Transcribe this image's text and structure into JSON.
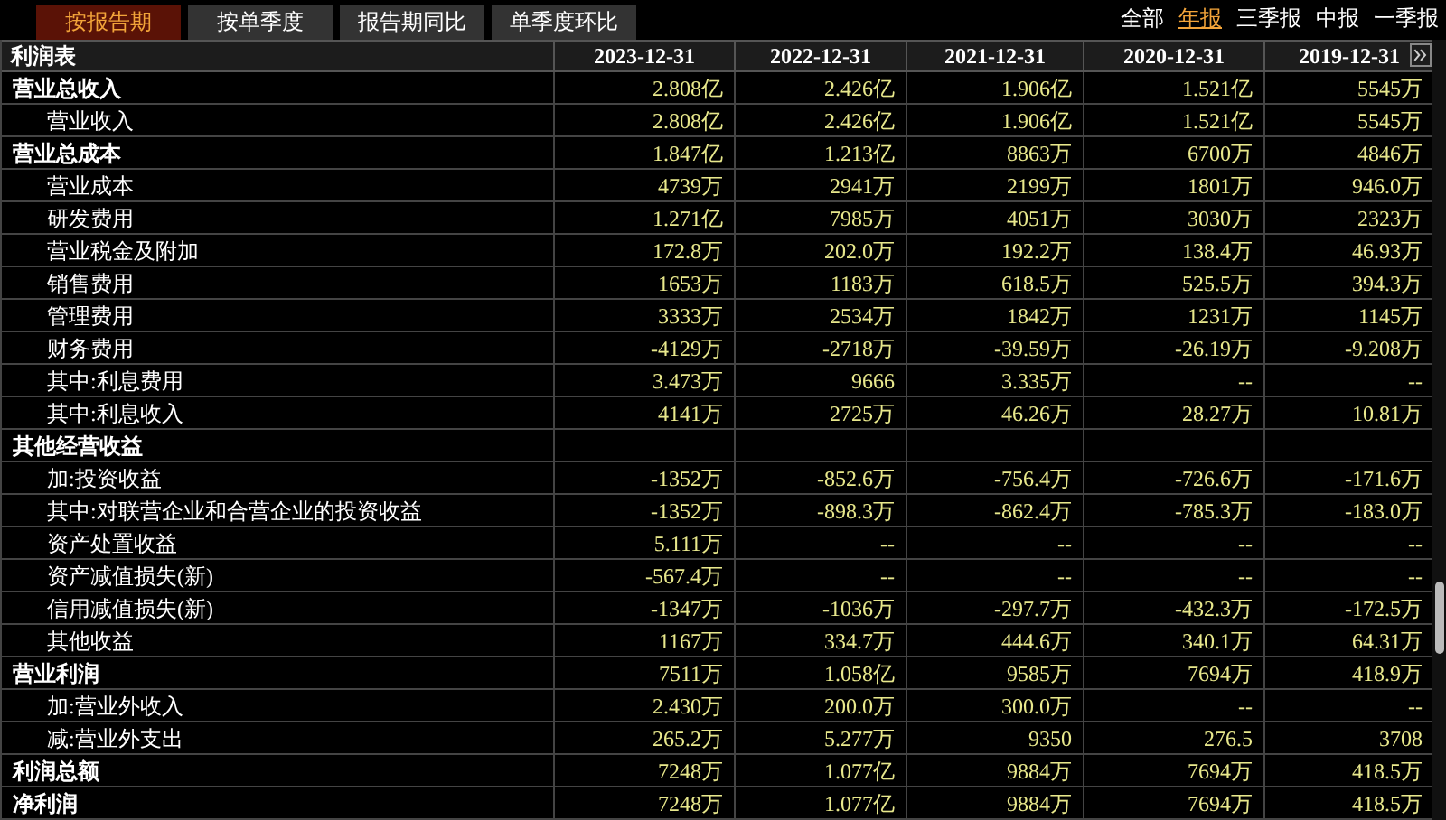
{
  "tabs": [
    {
      "label": "按报告期",
      "selected": true
    },
    {
      "label": "按单季度",
      "selected": false
    },
    {
      "label": "报告期同比",
      "selected": false
    },
    {
      "label": "单季度环比",
      "selected": false
    }
  ],
  "filters": [
    {
      "label": "全部",
      "selected": false
    },
    {
      "label": "年报",
      "selected": true
    },
    {
      "label": "三季报",
      "selected": false
    },
    {
      "label": "中报",
      "selected": false
    },
    {
      "label": "一季报",
      "selected": false
    }
  ],
  "table": {
    "title": "利润表",
    "columns": [
      "2023-12-31",
      "2022-12-31",
      "2021-12-31",
      "2020-12-31",
      "2019-12-31"
    ],
    "rows": [
      {
        "kind": "section",
        "label": "营业总收入",
        "values": [
          "2.808亿",
          "2.426亿",
          "1.906亿",
          "1.521亿",
          "5545万"
        ]
      },
      {
        "kind": "item",
        "label": "营业收入",
        "values": [
          "2.808亿",
          "2.426亿",
          "1.906亿",
          "1.521亿",
          "5545万"
        ]
      },
      {
        "kind": "section",
        "label": "营业总成本",
        "values": [
          "1.847亿",
          "1.213亿",
          "8863万",
          "6700万",
          "4846万"
        ]
      },
      {
        "kind": "item",
        "label": "营业成本",
        "values": [
          "4739万",
          "2941万",
          "2199万",
          "1801万",
          "946.0万"
        ]
      },
      {
        "kind": "item",
        "label": "研发费用",
        "values": [
          "1.271亿",
          "7985万",
          "4051万",
          "3030万",
          "2323万"
        ]
      },
      {
        "kind": "item",
        "label": "营业税金及附加",
        "values": [
          "172.8万",
          "202.0万",
          "192.2万",
          "138.4万",
          "46.93万"
        ]
      },
      {
        "kind": "item",
        "label": "销售费用",
        "values": [
          "1653万",
          "1183万",
          "618.5万",
          "525.5万",
          "394.3万"
        ]
      },
      {
        "kind": "item",
        "label": "管理费用",
        "values": [
          "3333万",
          "2534万",
          "1842万",
          "1231万",
          "1145万"
        ]
      },
      {
        "kind": "item",
        "label": "财务费用",
        "values": [
          "-4129万",
          "-2718万",
          "-39.59万",
          "-26.19万",
          "-9.208万"
        ]
      },
      {
        "kind": "item",
        "label": "其中:利息费用",
        "values": [
          "3.473万",
          "9666",
          "3.335万",
          "--",
          "--"
        ]
      },
      {
        "kind": "item",
        "label": "其中:利息收入",
        "values": [
          "4141万",
          "2725万",
          "46.26万",
          "28.27万",
          "10.81万"
        ]
      },
      {
        "kind": "section",
        "label": "其他经营收益",
        "values": []
      },
      {
        "kind": "item",
        "label": "加:投资收益",
        "values": [
          "-1352万",
          "-852.6万",
          "-756.4万",
          "-726.6万",
          "-171.6万"
        ]
      },
      {
        "kind": "item",
        "label": "其中:对联营企业和合营企业的投资收益",
        "values": [
          "-1352万",
          "-898.3万",
          "-862.4万",
          "-785.3万",
          "-183.0万"
        ]
      },
      {
        "kind": "item",
        "label": "资产处置收益",
        "values": [
          "5.111万",
          "--",
          "--",
          "--",
          "--"
        ]
      },
      {
        "kind": "item",
        "label": "资产减值损失(新)",
        "values": [
          "-567.4万",
          "--",
          "--",
          "--",
          "--"
        ]
      },
      {
        "kind": "item",
        "label": "信用减值损失(新)",
        "values": [
          "-1347万",
          "-1036万",
          "-297.7万",
          "-432.3万",
          "-172.5万"
        ]
      },
      {
        "kind": "item",
        "label": "其他收益",
        "values": [
          "1167万",
          "334.7万",
          "444.6万",
          "340.1万",
          "64.31万"
        ]
      },
      {
        "kind": "section",
        "label": "营业利润",
        "values": [
          "7511万",
          "1.058亿",
          "9585万",
          "7694万",
          "418.9万"
        ]
      },
      {
        "kind": "item",
        "label": "加:营业外收入",
        "values": [
          "2.430万",
          "200.0万",
          "300.0万",
          "--",
          "--"
        ]
      },
      {
        "kind": "item",
        "label": "减:营业外支出",
        "values": [
          "265.2万",
          "5.277万",
          "9350",
          "276.5",
          "3708"
        ]
      },
      {
        "kind": "section",
        "label": "利润总额",
        "values": [
          "7248万",
          "1.077亿",
          "9884万",
          "7694万",
          "418.5万"
        ]
      },
      {
        "kind": "section",
        "label": "净利润",
        "values": [
          "7248万",
          "1.077亿",
          "9884万",
          "7694万",
          "418.5万"
        ]
      }
    ]
  }
}
